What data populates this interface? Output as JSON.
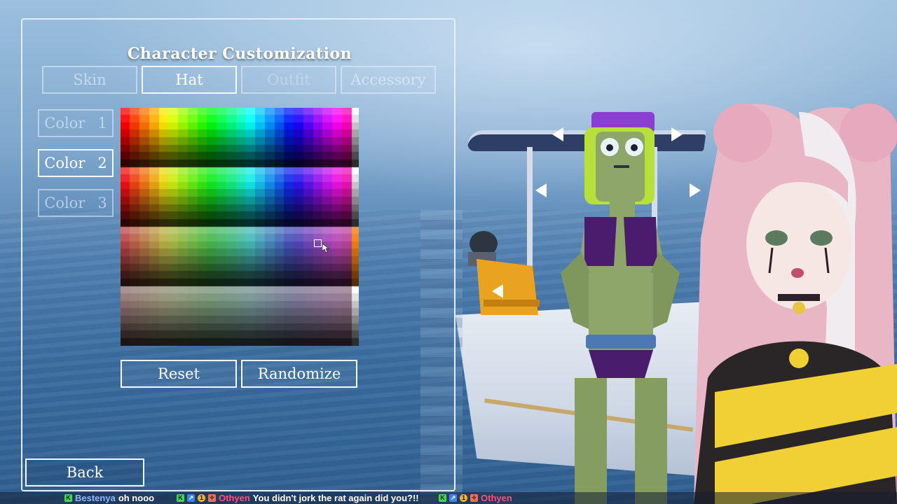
{
  "title": "Character Customization",
  "tabs": [
    {
      "label": "Skin",
      "state": "inactive"
    },
    {
      "label": "Hat",
      "state": "active"
    },
    {
      "label": "Outfit",
      "state": "disabled"
    },
    {
      "label": "Accessory",
      "state": "inactive"
    }
  ],
  "color_slots": [
    {
      "label": "Color",
      "number": "1",
      "state": "inactive"
    },
    {
      "label": "Color",
      "number": "2",
      "state": "active"
    },
    {
      "label": "Color",
      "number": "3",
      "state": "inactive"
    }
  ],
  "buttons": {
    "reset": "Reset",
    "randomize": "Randomize",
    "back": "Back"
  },
  "colors": {
    "panel_border": "#e6edf7",
    "hat_color": "#8a3fd1",
    "hair_color": "#b7e03a",
    "skin_color": "#8fa66a",
    "outfit_color": "#4a1c6e"
  },
  "chat": [
    {
      "user": "Bestenya",
      "text": "oh nooo",
      "badges": [
        "K"
      ]
    },
    {
      "user": "Othyen",
      "text": "You didn't jork the rat again did you?!!",
      "badges": [
        "K",
        "↗",
        "1",
        "✧"
      ]
    },
    {
      "user": "Othyen",
      "text": "",
      "badges": [
        "K",
        "↗",
        "1",
        "✧"
      ]
    }
  ]
}
